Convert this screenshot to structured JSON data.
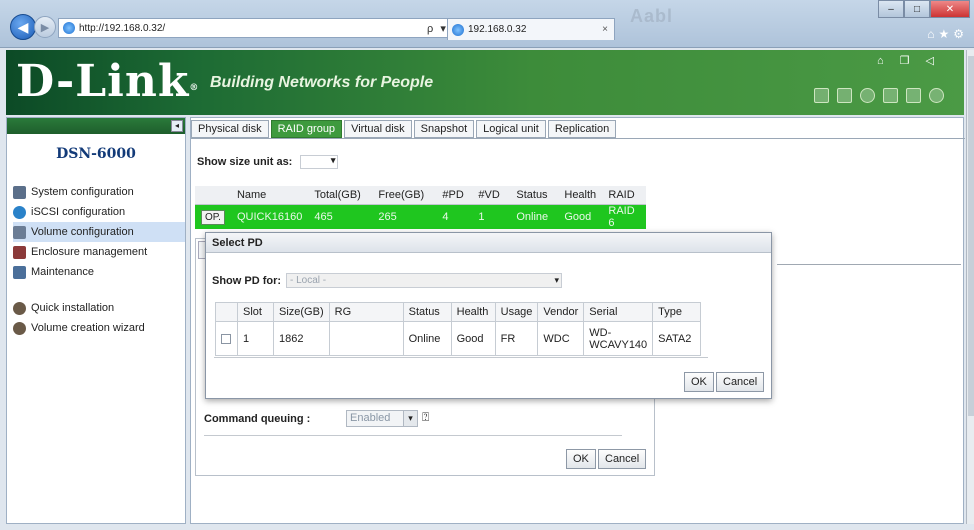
{
  "browser": {
    "address_url": "http://192.168.0.32/",
    "tab_title": "192.168.0.32",
    "tab_close": "×",
    "address_tools": "ρ ▾ ⊠ C ✕",
    "blurred_tabs": "Aabl"
  },
  "banner": {
    "logo": "D-Link",
    "registered": "®",
    "tagline": "Building Networks for People"
  },
  "sidebar": {
    "model": "DSN-6000",
    "items": [
      {
        "label": "System configuration",
        "icon": "system-config-icon",
        "color": "#5b6f8a"
      },
      {
        "label": "iSCSI configuration",
        "icon": "iscsi-globe-icon",
        "color": "#2a82c9"
      },
      {
        "label": "Volume configuration",
        "icon": "volume-config-icon",
        "color": "#6b7d95"
      },
      {
        "label": "Enclosure management",
        "icon": "enclosure-icon",
        "color": "#8b3a3a"
      },
      {
        "label": "Maintenance",
        "icon": "maintenance-icon",
        "color": "#4b6f9a"
      }
    ],
    "wizards": [
      {
        "label": "Quick installation",
        "icon": "quick-install-icon",
        "color": "#6a5a48"
      },
      {
        "label": "Volume creation wizard",
        "icon": "volume-wizard-icon",
        "color": "#6a5a48"
      }
    ]
  },
  "tabs": [
    "Physical disk",
    "RAID group",
    "Virtual disk",
    "Snapshot",
    "Logical unit",
    "Replication"
  ],
  "active_tab": "RAID group",
  "size_unit_label": "Show size unit as:",
  "raid_table": {
    "headers": [
      "Name",
      "Total(GB)",
      "Free(GB)",
      "#PD",
      "#VD",
      "Status",
      "Health",
      "RAID"
    ],
    "row": {
      "op": "OP.",
      "name": "QUICK16160",
      "total": "465",
      "free": "265",
      "pd": "4",
      "vd": "1",
      "status": "Online",
      "health": "Good",
      "raid": "RAID 6"
    }
  },
  "form": {
    "command_queuing_label": "Command queuing :",
    "command_queuing_value": "Enabled",
    "ok": "OK",
    "cancel": "Cancel"
  },
  "dialog": {
    "title": "Select PD",
    "show_pd_label": "Show PD for:",
    "show_pd_value": "- Local -",
    "headers": [
      "Slot",
      "Size(GB)",
      "RG",
      "Status",
      "Health",
      "Usage",
      "Vendor",
      "Serial",
      "Type"
    ],
    "rows": [
      {
        "slot": "1",
        "size": "1862",
        "rg": "",
        "status": "Online",
        "health": "Good",
        "usage": "FR",
        "vendor": "WDC",
        "serial": "WD-WCAVY140",
        "type": "SATA2"
      }
    ],
    "ok": "OK",
    "cancel": "Cancel"
  },
  "colors": {
    "accent_green": "#3e9a3e",
    "row_green": "#1fc61f",
    "brand_dark": "#0c4a26"
  }
}
